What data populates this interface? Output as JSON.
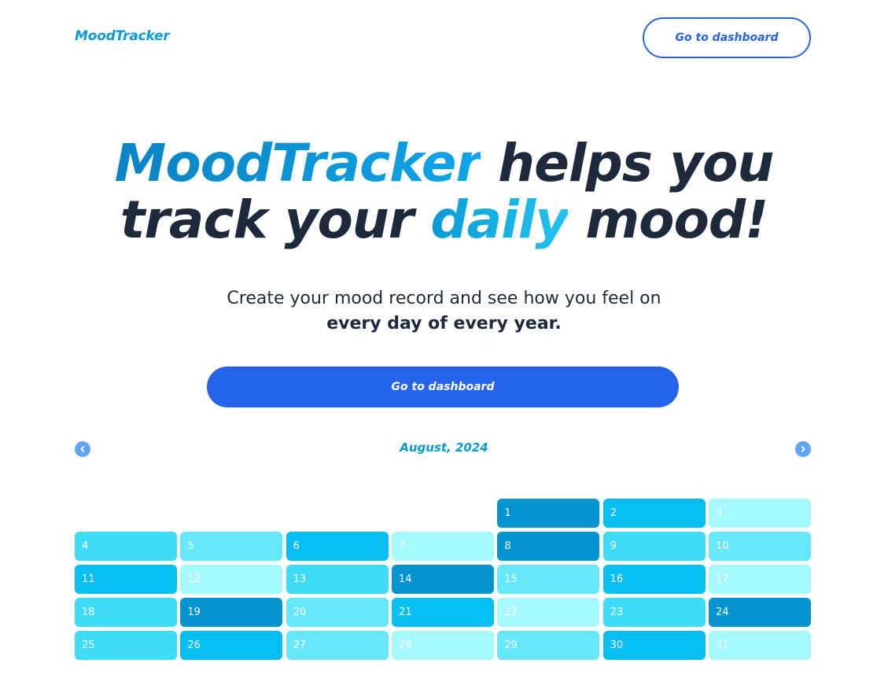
{
  "header": {
    "logo": "MoodTracker",
    "nav_button": "Go to dashboard"
  },
  "hero": {
    "title_brand": "MoodTracker",
    "title_part1": " helps you",
    "title_part2": "track your ",
    "title_accent": "daily",
    "title_part3": " mood!",
    "subtitle_line1": "Create your mood record and see how you feel on",
    "subtitle_line2": "every day of every year.",
    "cta_label": "Go to dashboard"
  },
  "calendar": {
    "month_label": "August, 2024",
    "prev_icon": "chevron-left-icon",
    "next_icon": "chevron-right-icon",
    "leading_empty_days": 4,
    "mood_colors": {
      "1": "#a5f8fc",
      "2": "#67e8f9",
      "3": "#3fdcf7",
      "4": "#06bff0",
      "5": "#0494d0"
    },
    "days": [
      {
        "label": "1",
        "mood": 5
      },
      {
        "label": "2",
        "mood": 4
      },
      {
        "label": "3",
        "mood": 1
      },
      {
        "label": "4",
        "mood": 3
      },
      {
        "label": "5",
        "mood": 2
      },
      {
        "label": "6",
        "mood": 4
      },
      {
        "label": "7",
        "mood": 1
      },
      {
        "label": "8",
        "mood": 5
      },
      {
        "label": "9",
        "mood": 3
      },
      {
        "label": "10",
        "mood": 2
      },
      {
        "label": "11",
        "mood": 4
      },
      {
        "label": "12",
        "mood": 1
      },
      {
        "label": "13",
        "mood": 3
      },
      {
        "label": "14",
        "mood": 5
      },
      {
        "label": "15",
        "mood": 2
      },
      {
        "label": "16",
        "mood": 4
      },
      {
        "label": "17",
        "mood": 1
      },
      {
        "label": "18",
        "mood": 3
      },
      {
        "label": "19",
        "mood": 5
      },
      {
        "label": "20",
        "mood": 2
      },
      {
        "label": "21",
        "mood": 4
      },
      {
        "label": "22",
        "mood": 1
      },
      {
        "label": "23",
        "mood": 3
      },
      {
        "label": "24",
        "mood": 5
      },
      {
        "label": "25",
        "mood": 3
      },
      {
        "label": "26",
        "mood": 4
      },
      {
        "label": "27",
        "mood": 2
      },
      {
        "label": "28",
        "mood": 1
      },
      {
        "label": "29",
        "mood": 2
      },
      {
        "label": "30",
        "mood": 4
      },
      {
        "label": "31",
        "mood": 1
      }
    ]
  }
}
